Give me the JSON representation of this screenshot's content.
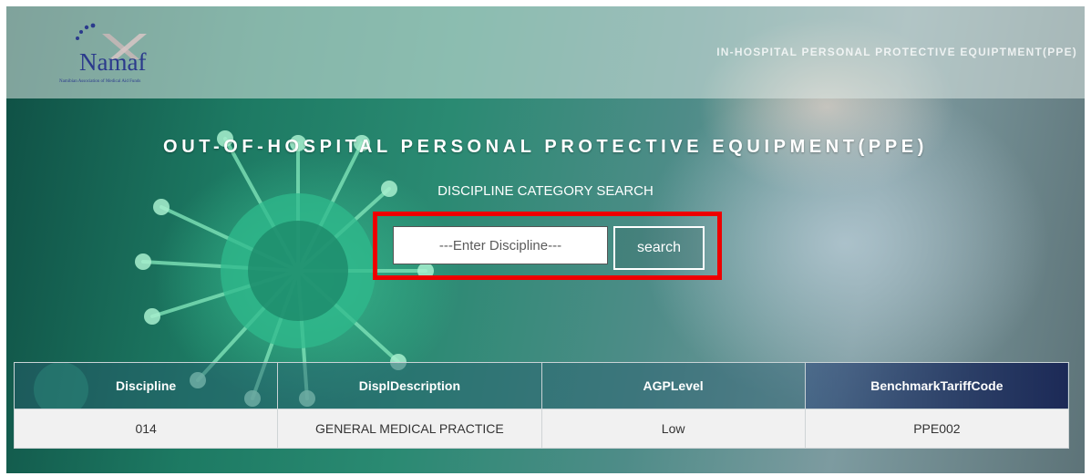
{
  "header": {
    "logo_text": "Namaf",
    "logo_subtext": "Namibian Association of Medical Aid Funds",
    "nav_link": "IN-HOSPITAL PERSONAL PROTECTIVE EQUIPTMENT(PPE)"
  },
  "hero": {
    "title": "OUT-OF-HOSPITAL PERSONAL PROTECTIVE EQUIPMENT(PPE)",
    "subtitle": "DISCIPLINE CATEGORY SEARCH"
  },
  "search": {
    "value": "",
    "placeholder": "---Enter Discipline---",
    "button_label": "search",
    "highlight_color": "#ee0000"
  },
  "table": {
    "columns": [
      "Discipline",
      "DisplDescription",
      "AGPLevel",
      "BenchmarkTariffCode"
    ],
    "rows": [
      [
        "014",
        "GENERAL MEDICAL PRACTICE",
        "Low",
        "PPE002"
      ]
    ]
  },
  "colors": {
    "logo_blue": "#2b3a8c",
    "table_row_bg": "#f1f1f1"
  }
}
